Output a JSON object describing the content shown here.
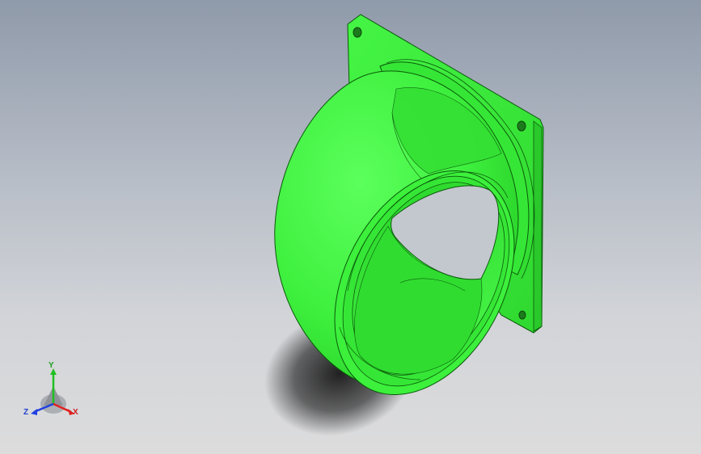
{
  "viewport": {
    "background_top": "#8f9aaa",
    "background_bottom": "#dcdcdd"
  },
  "model": {
    "part_color": "#3ef03e",
    "part_shade": "#2bd42b",
    "part_dark": "#1fb01f",
    "edge_color": "#0a5a0a"
  },
  "triad": {
    "x_label": "X",
    "y_label": "Y",
    "z_label": "Z",
    "x_color": "#e02020",
    "y_color": "#20c020",
    "z_color": "#2040e0"
  }
}
